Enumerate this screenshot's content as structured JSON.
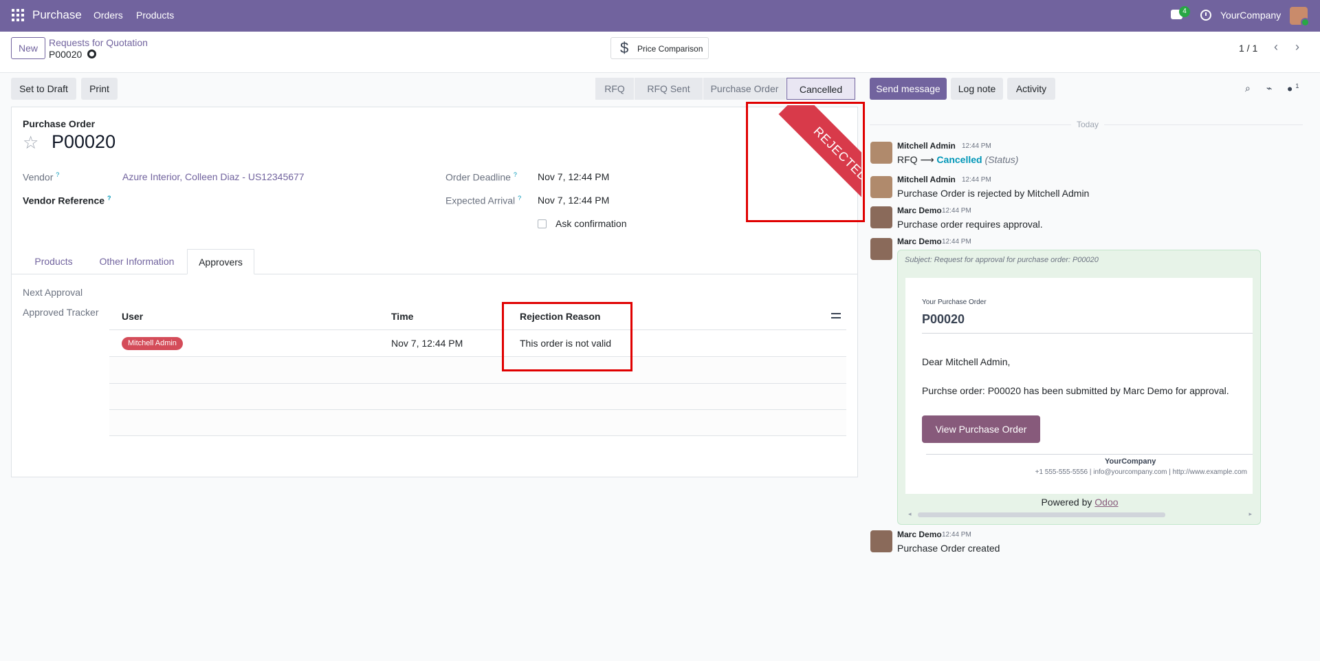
{
  "navbar": {
    "app_name": "Purchase",
    "menus": [
      "Orders",
      "Products"
    ],
    "messages_count": "4",
    "company": "YourCompany"
  },
  "control": {
    "new_label": "New",
    "breadcrumb": "Requests for Quotation",
    "record": "P00020",
    "price_comparison": "Price Comparison",
    "pager": "1 / 1"
  },
  "actions": {
    "set_to_draft": "Set to Draft",
    "print": "Print"
  },
  "stages": [
    "RFQ",
    "RFQ Sent",
    "Purchase Order",
    "Cancelled"
  ],
  "form": {
    "subtitle": "Purchase Order",
    "name": "P00020",
    "vendor_label": "Vendor",
    "vendor_value": "Azure Interior, Colleen Diaz - US12345677",
    "vendor_ref_label": "Vendor Reference",
    "order_deadline_label": "Order Deadline",
    "order_deadline_value": "Nov 7, 12:44 PM",
    "expected_arrival_label": "Expected Arrival",
    "expected_arrival_value": "Nov 7, 12:44 PM",
    "ask_confirmation": "Ask confirmation",
    "ribbon": "REJECTED",
    "help_mark": "?"
  },
  "tabs": [
    "Products",
    "Other Information",
    "Approvers"
  ],
  "approvers": {
    "next_approval_label": "Next Approval",
    "approved_tracker_label": "Approved Tracker",
    "columns": [
      "User",
      "Time",
      "Rejection Reason"
    ],
    "rows": [
      {
        "user": "Mitchell Admin",
        "time": "Nov 7, 12:44 PM",
        "reason": "This order is not valid"
      }
    ]
  },
  "chatter": {
    "send_message": "Send message",
    "log_note": "Log note",
    "activity": "Activity",
    "followers_count": "1",
    "today": "Today",
    "messages": [
      {
        "author": "Mitchell Admin",
        "time": "12:44 PM",
        "old": "RFQ",
        "arrow": "⟶",
        "new": "Cancelled",
        "field": "(Status)"
      },
      {
        "author": "Mitchell Admin",
        "time": "12:44 PM",
        "body": "Purchase Order is rejected by Mitchell Admin"
      },
      {
        "author": "Marc Demo",
        "time": "12:44 PM",
        "body": "Purchase order requires approval."
      },
      {
        "author": "Marc Demo",
        "time": "12:44 PM"
      },
      {
        "author": "Marc Demo",
        "time": "12:44 PM",
        "body": "Purchase Order created"
      }
    ],
    "mail": {
      "subject": "Subject: Request for approval for purchase order: P00020",
      "small_title": "Your Purchase Order",
      "big_title": "P00020",
      "greeting": "Dear Mitchell Admin,",
      "body": "Purchse order: P00020 has been submitted by Marc Demo for approval.",
      "button": "View Purchase Order",
      "company": "YourCompany",
      "footer": "+1 555-555-5556 | info@yourcompany.com | http://www.example.com",
      "powered_by": "Powered by",
      "powered_link": "Odoo"
    }
  },
  "colors": {
    "brand": "#71639e",
    "ribbon": "#d83a4a",
    "highlight_box": "#e00000",
    "badge": "#d44c59"
  }
}
